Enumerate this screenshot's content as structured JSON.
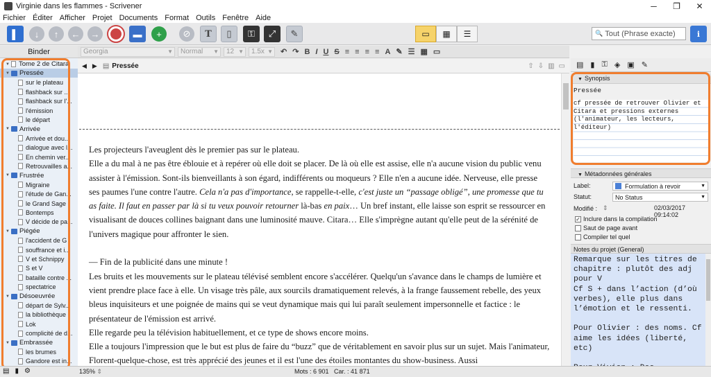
{
  "window": {
    "title": "Virginie dans les flammes - Scrivener"
  },
  "window_controls": {
    "minimize": "─",
    "maximize": "❐",
    "close": "✕"
  },
  "menu": [
    "Fichier",
    "Éditer",
    "Afficher",
    "Projet",
    "Documents",
    "Format",
    "Outils",
    "Fenêtre",
    "Aide"
  ],
  "search": {
    "placeholder": "Tout (Phrase exacte)",
    "glyph": "🔍"
  },
  "info_label": "i",
  "format": {
    "font": "Georgia",
    "style": "Normal",
    "size": "12",
    "spacing": "1.5x",
    "bold": "B",
    "italic": "I",
    "underline": "U",
    "strike": "S"
  },
  "binder": {
    "header": "Binder",
    "items": [
      {
        "label": "Tome 2 de Citara",
        "type": "root"
      },
      {
        "label": "Pressée",
        "type": "folder",
        "selected": true
      },
      {
        "label": "sur le plateau",
        "type": "doc"
      },
      {
        "label": "flashback sur ...",
        "type": "doc"
      },
      {
        "label": "flashback sur l'...",
        "type": "doc"
      },
      {
        "label": "l'émission",
        "type": "doc"
      },
      {
        "label": "le départ",
        "type": "doc"
      },
      {
        "label": "Arrivée",
        "type": "folder"
      },
      {
        "label": "Arrivée et dou...",
        "type": "doc"
      },
      {
        "label": "dialogue avec l...",
        "type": "doc"
      },
      {
        "label": "En chemin ver...",
        "type": "doc"
      },
      {
        "label": "Retrouvailles a...",
        "type": "doc"
      },
      {
        "label": "Frustrée",
        "type": "folder"
      },
      {
        "label": "Migraine",
        "type": "doc"
      },
      {
        "label": "l'étude de Gan...",
        "type": "doc"
      },
      {
        "label": "le Grand Sage",
        "type": "doc"
      },
      {
        "label": "Bontemps",
        "type": "doc"
      },
      {
        "label": "V décide de pa...",
        "type": "doc"
      },
      {
        "label": "Piégée",
        "type": "folder"
      },
      {
        "label": "l'accident de G",
        "type": "doc"
      },
      {
        "label": "souffrance et i...",
        "type": "doc"
      },
      {
        "label": "V et Schnippy",
        "type": "doc"
      },
      {
        "label": "S et V",
        "type": "doc"
      },
      {
        "label": "bataille contre ...",
        "type": "doc"
      },
      {
        "label": "spectatrice",
        "type": "doc"
      },
      {
        "label": "Désoeuvrée",
        "type": "folder"
      },
      {
        "label": "départ de Sylv...",
        "type": "doc"
      },
      {
        "label": "la bibliothèque",
        "type": "doc"
      },
      {
        "label": "Lok",
        "type": "doc"
      },
      {
        "label": "complicité de d...",
        "type": "doc"
      },
      {
        "label": "Embrassée",
        "type": "folder"
      },
      {
        "label": "les brumes",
        "type": "doc"
      },
      {
        "label": "Gandore est in...",
        "type": "doc"
      }
    ]
  },
  "editor": {
    "doc_title": "Pressée",
    "paragraphs": [
      [
        {
          "t": "Les projecteurs l'aveuglent dès le premier pas sur le plateau."
        }
      ],
      [
        {
          "t": "Elle a du mal à ne pas être éblouie et à repérer où elle doit se placer. De là où elle est assise, elle n'a aucune vision du public venu assister à l'émission. Sont-ils bienveillants à son égard, indifférents ou moqueurs ? Elle n'en a aucune idée. Nerveuse, elle presse ses paumes l'une contre l'autre. "
        },
        {
          "t": "Cela n'a pas d'importance",
          "i": true
        },
        {
          "t": ", se rappelle-t-elle, "
        },
        {
          "t": "c'est juste un “passage obligé”, une promesse que tu as faite. Il faut en passer par là si tu veux pouvoir retourner",
          "i": true
        },
        {
          "t": " là-bas "
        },
        {
          "t": "en paix",
          "i": true
        },
        {
          "t": "… Un bref instant, elle laisse son esprit se ressourcer en visualisant de douces collines baignant dans une luminosité mauve. Citara… Elle s'imprègne autant qu'elle peut de la sérénité de l'univers magique pour affronter le sien."
        }
      ],
      [],
      [
        {
          "t": "— Fin de la publicité dans une minute !"
        }
      ],
      [
        {
          "t": "Les bruits et les mouvements sur le plateau télévisé semblent encore s'accélérer. Quelqu'un s'avance dans le champs de lumière et vient prendre place face à elle. Un visage très pâle, aux sourcils dramatiquement relevés, à la frange faussement rebelle, des yeux bleus inquisiteurs et une poignée de mains qui se veut dynamique mais qui lui paraît seulement impersonnelle et factice : le présentateur de l'émission est arrivé."
        }
      ],
      [
        {
          "t": "Elle regarde peu la télévision habituellement, et ce type de shows encore moins."
        }
      ],
      [
        {
          "t": "Elle a toujours l'impression que le but est plus de faire du “buzz” que de véritablement en savoir plus sur un sujet. Mais l'animateur, Florent-quelque-chose, est très apprécié des jeunes et il est l'une des étoiles montantes du show-business. Aussi"
        }
      ]
    ]
  },
  "inspector": {
    "synopsis_label": "Synopsis",
    "synopsis_title": "Pressée",
    "synopsis_text": "cf pressée de retrouver Olivier et Citara et pressions externes (l'animateur, les lecteurs, l'éditeur)",
    "metadata_label": "Métadonnées générales",
    "label_key": "Label:",
    "label_value": "Formulation à revoir",
    "label_color": "#4a7fd6",
    "status_key": "Statut:",
    "status_value": "No Status",
    "modified_key": "Modifié :",
    "modified_value": "02/03/2017 09:14:02",
    "check_compile": "Inclure dans la compilation",
    "check_pagebreak": "Saut de page avant",
    "check_asis": "Compiler tel quel",
    "notes_label": "Notes du projet (General)",
    "notes": [
      "Remarque sur les titres de chapitre : plutôt des adj pour V",
      "Cf S + dans l’action (d’où verbes), elle plus dans l’émotion et le ressenti.",
      "",
      "Pour Olivier : des noms. Cf aime les idées (liberté, etc)",
      "",
      "Pour Vivien : Des"
    ]
  },
  "status": {
    "zoom": "135%",
    "words": "Mots : 6 901",
    "chars": "Car. : 41 871"
  },
  "colors": {
    "accent_outline": "#f07d2e",
    "selected_bg": "#b9cde6",
    "notes_bg": "#d8e4f8"
  }
}
